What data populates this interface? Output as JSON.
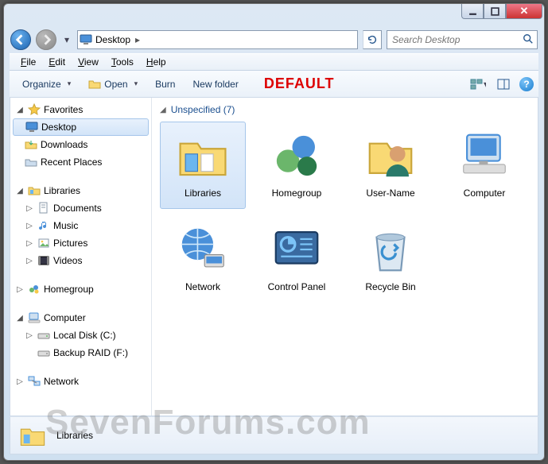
{
  "titlebar": {
    "min": "_",
    "max": "□",
    "close": "✕"
  },
  "address": {
    "location": "Desktop",
    "separator": "▸"
  },
  "search": {
    "placeholder": "Search Desktop"
  },
  "menubar": [
    "File",
    "Edit",
    "View",
    "Tools",
    "Help"
  ],
  "toolbar": {
    "organize": "Organize",
    "open": "Open",
    "burn": "Burn",
    "newfolder": "New folder",
    "default_label": "DEFAULT"
  },
  "sidebar": {
    "favorites": {
      "label": "Favorites",
      "items": [
        "Desktop",
        "Downloads",
        "Recent Places"
      ]
    },
    "libraries": {
      "label": "Libraries",
      "items": [
        "Documents",
        "Music",
        "Pictures",
        "Videos"
      ]
    },
    "homegroup": {
      "label": "Homegroup"
    },
    "computer": {
      "label": "Computer",
      "items": [
        "Local Disk (C:)",
        "Backup RAID (F:)"
      ]
    },
    "network": {
      "label": "Network"
    }
  },
  "content": {
    "header": "Unspecified (7)",
    "items": [
      "Libraries",
      "Homegroup",
      "User-Name",
      "Computer",
      "Network",
      "Control Panel",
      "Recycle Bin"
    ]
  },
  "details": {
    "name": "Libraries"
  },
  "watermark": "SevenForums.com"
}
